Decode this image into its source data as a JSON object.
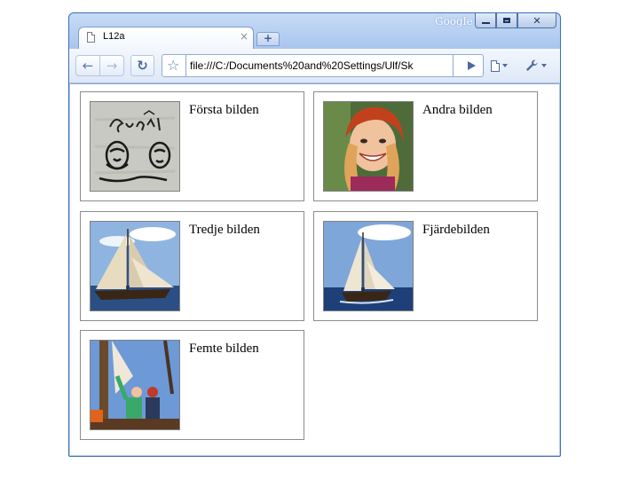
{
  "window": {
    "brand_label": "Google",
    "controls": {
      "minimize_icon": "minimize-icon",
      "maximize_icon": "maximize-icon",
      "close_icon": "close-icon"
    }
  },
  "tabs": [
    {
      "title": "L12a",
      "close_glyph": "×"
    }
  ],
  "new_tab_glyph": "+",
  "toolbar": {
    "back_glyph": "←",
    "forward_glyph": "→",
    "reload_glyph": "↻",
    "bookmark_glyph": "☆",
    "address": "file:///C:/Documents%20and%20Settings/Ulf/Sk"
  },
  "gallery": [
    {
      "caption": "Första bilden",
      "image": "graal-sketch"
    },
    {
      "caption": "Andra bilden",
      "image": "smiling-girl"
    },
    {
      "caption": "Tredje bilden",
      "image": "sailboat"
    },
    {
      "caption": "Fjärdebilden",
      "image": "sailboat"
    },
    {
      "caption": "Femte bilden",
      "image": "sailors-on-deck"
    }
  ],
  "colors": {
    "frame_blue": "#3b6fb6",
    "card_border": "#8c8c8c"
  }
}
